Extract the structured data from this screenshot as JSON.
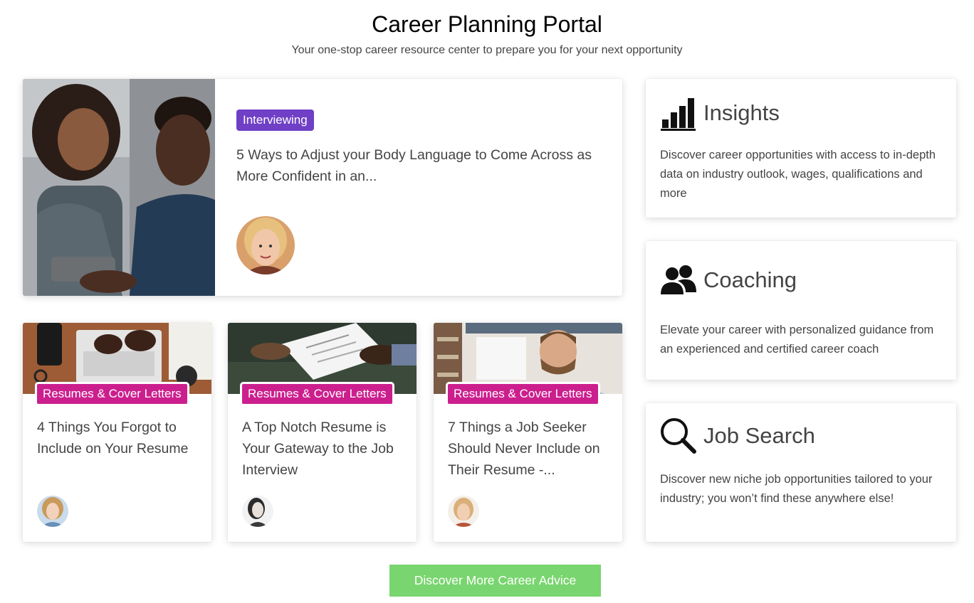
{
  "header": {
    "title": "Career Planning Portal",
    "subtitle": "Your one-stop career resource center to prepare you for your next opportunity"
  },
  "featured": {
    "tag": "Interviewing",
    "title": "5 Ways to Adjust your Body Language to Come Across as More Confident in an...",
    "image": "people-shaking-hands-photo",
    "author_avatar": "woman-author-avatar"
  },
  "articles": [
    {
      "tag": "Resumes & Cover Letters",
      "title": "4 Things You Forgot to Include on Your Resume",
      "image": "laptop-typing-photo",
      "author_avatar": "woman-author-avatar"
    },
    {
      "tag": "Resumes & Cover Letters",
      "title": "A Top Notch Resume is Your Gateway to the Job Interview",
      "image": "resume-handoff-photo",
      "author_avatar": "woman-author-avatar"
    },
    {
      "tag": "Resumes & Cover Letters",
      "title": "7 Things a Job Seeker Should Never Include on Their Resume -...",
      "image": "man-thinking-photo",
      "author_avatar": "woman-author-avatar"
    }
  ],
  "sidebar": [
    {
      "icon": "bar-chart-icon",
      "heading": "Insights",
      "text": "Discover career opportunities with access to in-depth data on industry outlook, wages, qualifications and more"
    },
    {
      "icon": "users-icon",
      "heading": "Coaching",
      "text": "Elevate your career with personalized guidance from an experienced and certified career coach"
    },
    {
      "icon": "search-icon",
      "heading": "Job Search",
      "text": "Discover new niche job opportunities tailored to your industry; you won’t find these anywhere else!"
    }
  ],
  "cta": {
    "label": "Discover More Career Advice"
  },
  "colors": {
    "interviewing_tag": "#6f3fc6",
    "resume_tag": "#cc1f8e",
    "cta_button": "#79d56f"
  }
}
